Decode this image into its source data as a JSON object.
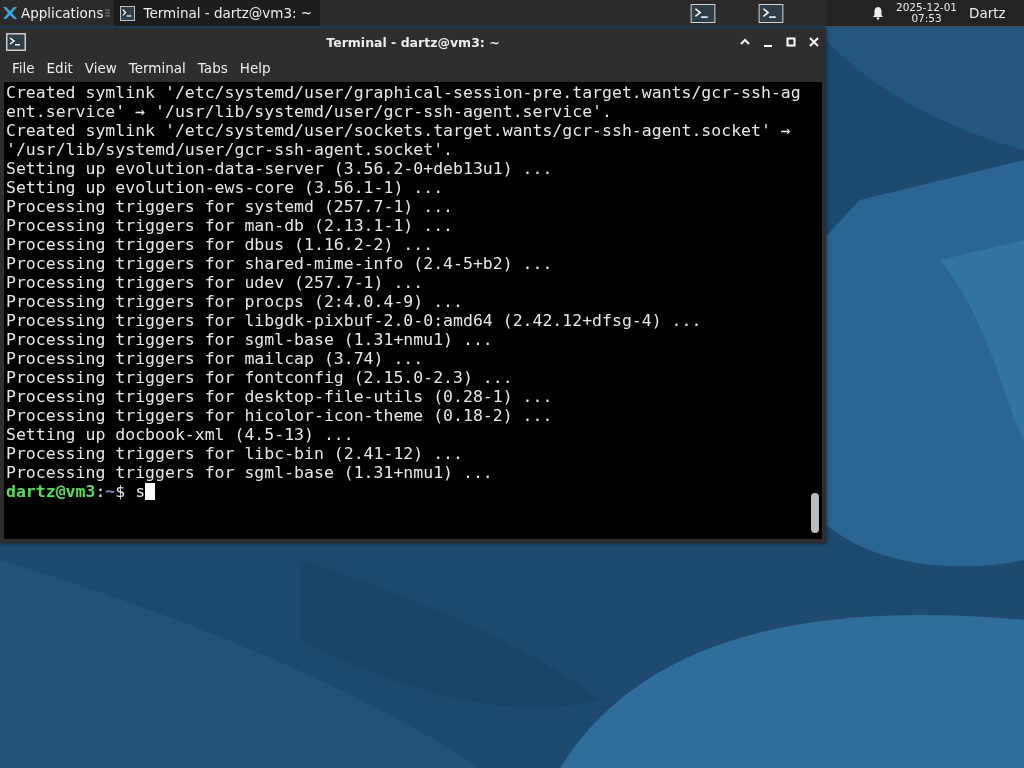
{
  "panel": {
    "apps_label": "Applications",
    "tasks": [
      {
        "label": "Terminal - dartz@vm3: ~",
        "selected": true
      }
    ],
    "clock": {
      "date": "2025-12-01",
      "time": "07:53"
    },
    "user": "Dartz"
  },
  "window": {
    "title": "Terminal - dartz@vm3: ~",
    "menu": [
      "File",
      "Edit",
      "View",
      "Terminal",
      "Tabs",
      "Help"
    ],
    "lines": [
      "Created symlink '/etc/systemd/user/graphical-session-pre.target.wants/gcr-ssh-ag",
      "ent.service' → '/usr/lib/systemd/user/gcr-ssh-agent.service'.",
      "Created symlink '/etc/systemd/user/sockets.target.wants/gcr-ssh-agent.socket' →",
      "'/usr/lib/systemd/user/gcr-ssh-agent.socket'.",
      "Setting up evolution-data-server (3.56.2-0+deb13u1) ...",
      "Setting up evolution-ews-core (3.56.1-1) ...",
      "Processing triggers for systemd (257.7-1) ...",
      "Processing triggers for man-db (2.13.1-1) ...",
      "Processing triggers for dbus (1.16.2-2) ...",
      "Processing triggers for shared-mime-info (2.4-5+b2) ...",
      "Processing triggers for udev (257.7-1) ...",
      "Processing triggers for procps (2:4.0.4-9) ...",
      "Processing triggers for libgdk-pixbuf-2.0-0:amd64 (2.42.12+dfsg-4) ...",
      "Processing triggers for sgml-base (1.31+nmu1) ...",
      "Processing triggers for mailcap (3.74) ...",
      "Processing triggers for fontconfig (2.15.0-2.3) ...",
      "Processing triggers for desktop-file-utils (0.28-1) ...",
      "Processing triggers for hicolor-icon-theme (0.18-2) ...",
      "Setting up docbook-xml (4.5-13) ...",
      "Processing triggers for libc-bin (2.41-12) ...",
      "Processing triggers for sgml-base (1.31+nmu1) ..."
    ],
    "prompt": {
      "user_host": "dartz@vm3",
      "separator": ":",
      "path": "~",
      "symbol": "$",
      "input": "s"
    }
  }
}
